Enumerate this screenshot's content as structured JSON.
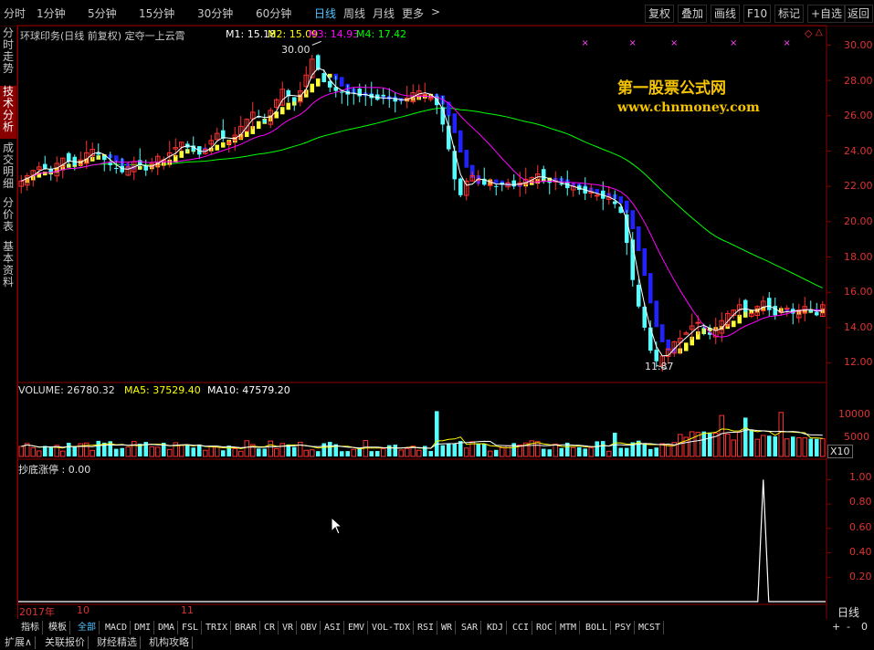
{
  "toolbar": {
    "timeframes": [
      "分时",
      "1分钟",
      "5分钟",
      "15分钟",
      "30分钟",
      "60分钟",
      "日线",
      "周线",
      "月线",
      "更多"
    ],
    "more_arrow": ">",
    "right_buttons": [
      "复权",
      "叠加",
      "画线",
      "F10",
      "标记",
      "+自选",
      "返回"
    ]
  },
  "left_tabs": [
    "分时走势",
    "技术分析",
    "成交明细",
    "分价表",
    "基本资料"
  ],
  "main_info": {
    "title": "环球印务(日线 前复权) 定夺一上云霄",
    "m1": "M1: 15.18",
    "m2": "M2: 15.09",
    "m3": "M3: 14.93",
    "m4": "M4: 17.42",
    "high_label": "30.00",
    "low_label": "11.87"
  },
  "watermark": {
    "line1": "第一股票公式网",
    "line2": "www.chnmoney.com"
  },
  "volume_info": {
    "label": "VOLUME: 26780.32",
    "ma5": "MA5: 37529.40",
    "ma10": "MA10: 47579.20",
    "unit": "X10"
  },
  "indicator_info": {
    "label": "抄底涨停 : 0.00"
  },
  "axis": {
    "price_ticks": [
      "30.00",
      "28.00",
      "26.00",
      "24.00",
      "22.00",
      "20.00",
      "18.00",
      "16.00",
      "14.00",
      "12.00"
    ],
    "volume_ticks": [
      "10000",
      "5000"
    ],
    "indicator_ticks": [
      "1.00",
      "0.80",
      "0.60",
      "0.40",
      "0.20"
    ],
    "x_labels": [
      "2017年",
      "10",
      "11"
    ],
    "period_label": "日线",
    "zoom": [
      "+",
      "-",
      "0"
    ]
  },
  "indicator_tabs": [
    "指标",
    "模板",
    "全部",
    "MACD",
    "DMI",
    "DMA",
    "FSL",
    "TRIX",
    "BRAR",
    "CR",
    "VR",
    "OBV",
    "ASI",
    "EMV",
    "VOL-TDX",
    "RSI",
    "WR",
    "SAR",
    "KDJ",
    "CCI",
    "ROC",
    "MTM",
    "BOLL",
    "PSY",
    "MCST"
  ],
  "bottom_tabs": [
    "扩展∧",
    "关联报价",
    "财经精选",
    "机构攻略"
  ],
  "colors": {
    "up": "#ff3030",
    "down": "#54ffff",
    "m1": "#ffffff",
    "m2": "#ffff00",
    "m3": "#ff00ff",
    "m4": "#00ff00",
    "grid": "#8a0000",
    "accent": "#4fc3ff",
    "watermark": "#f5c400",
    "yellow_band": "#ffff33",
    "blue_band": "#2222ff"
  },
  "chart_data": {
    "type": "candlestick",
    "title": "环球印务(日线 前复权) 定夺一上云霄",
    "price_range": [
      11,
      31
    ],
    "closes": [
      22.3,
      22.6,
      22.9,
      23.1,
      23.0,
      22.8,
      23.3,
      23.6,
      23.4,
      23.2,
      23.5,
      23.9,
      24.1,
      23.8,
      23.5,
      23.2,
      23.0,
      22.8,
      23.1,
      23.4,
      23.2,
      22.9,
      23.3,
      23.7,
      23.5,
      23.9,
      24.2,
      24.5,
      24.2,
      24.0,
      23.8,
      24.1,
      24.6,
      25.0,
      24.7,
      24.5,
      24.9,
      25.4,
      25.8,
      26.2,
      25.9,
      25.6,
      26.3,
      26.9,
      27.5,
      27.1,
      26.8,
      27.4,
      28.3,
      29.2,
      28.6,
      27.9,
      27.6,
      27.4,
      27.3,
      27.2,
      27.3,
      27.1,
      27.2,
      27.0,
      26.9,
      27.1,
      27.0,
      26.8,
      26.9,
      27.0,
      27.3,
      27.4,
      27.2,
      27.0,
      26.6,
      25.5,
      24.1,
      22.4,
      21.5,
      22.3,
      22.6,
      22.4,
      22.1,
      22.3,
      22.0,
      22.1,
      22.2,
      22.0,
      22.2,
      22.4,
      22.5,
      22.7,
      22.4,
      22.2,
      22.3,
      22.1,
      21.9,
      22.0,
      21.8,
      21.6,
      21.7,
      21.5,
      21.3,
      21.4,
      21.0,
      20.5,
      18.8,
      16.7,
      15.2,
      14.0,
      12.7,
      12.1,
      12.4,
      12.8,
      13.2,
      13.4,
      13.7,
      14.1,
      14.3,
      14.0,
      13.6,
      13.9,
      14.4,
      14.8,
      15.0,
      15.3,
      14.9,
      14.8,
      15.2,
      15.5,
      15.0,
      14.7,
      14.9,
      15.1,
      14.8,
      15.0,
      15.2,
      14.9,
      14.7,
      15.3
    ],
    "annotations": [
      {
        "label": "30.00",
        "value": 30.0
      },
      {
        "label": "11.87",
        "value": 11.87
      }
    ],
    "x_labels": [
      "2017年",
      "10",
      "11"
    ],
    "series": [
      {
        "name": "M1",
        "value": 15.18
      },
      {
        "name": "M2",
        "value": 15.09
      },
      {
        "name": "M3",
        "value": 14.93
      },
      {
        "name": "M4",
        "value": 17.42
      }
    ],
    "volume": {
      "label": "VOLUME",
      "value": 26780.32,
      "ma5": 37529.4,
      "ma10": 47579.2,
      "unit": "X10",
      "ylim": [
        0,
        11000
      ],
      "spikes": [
        {
          "index": 70,
          "value": 10500
        },
        {
          "index": 100,
          "value": 5500
        },
        {
          "index": 118,
          "value": 9500
        },
        {
          "index": 122,
          "value": 9000
        },
        {
          "index": 128,
          "value": 10200
        }
      ]
    },
    "indicator": {
      "label": "抄底涨停",
      "value": 0.0,
      "ylim": [
        0,
        1.1
      ],
      "spike_index": 125,
      "spike_value": 1.0
    }
  }
}
